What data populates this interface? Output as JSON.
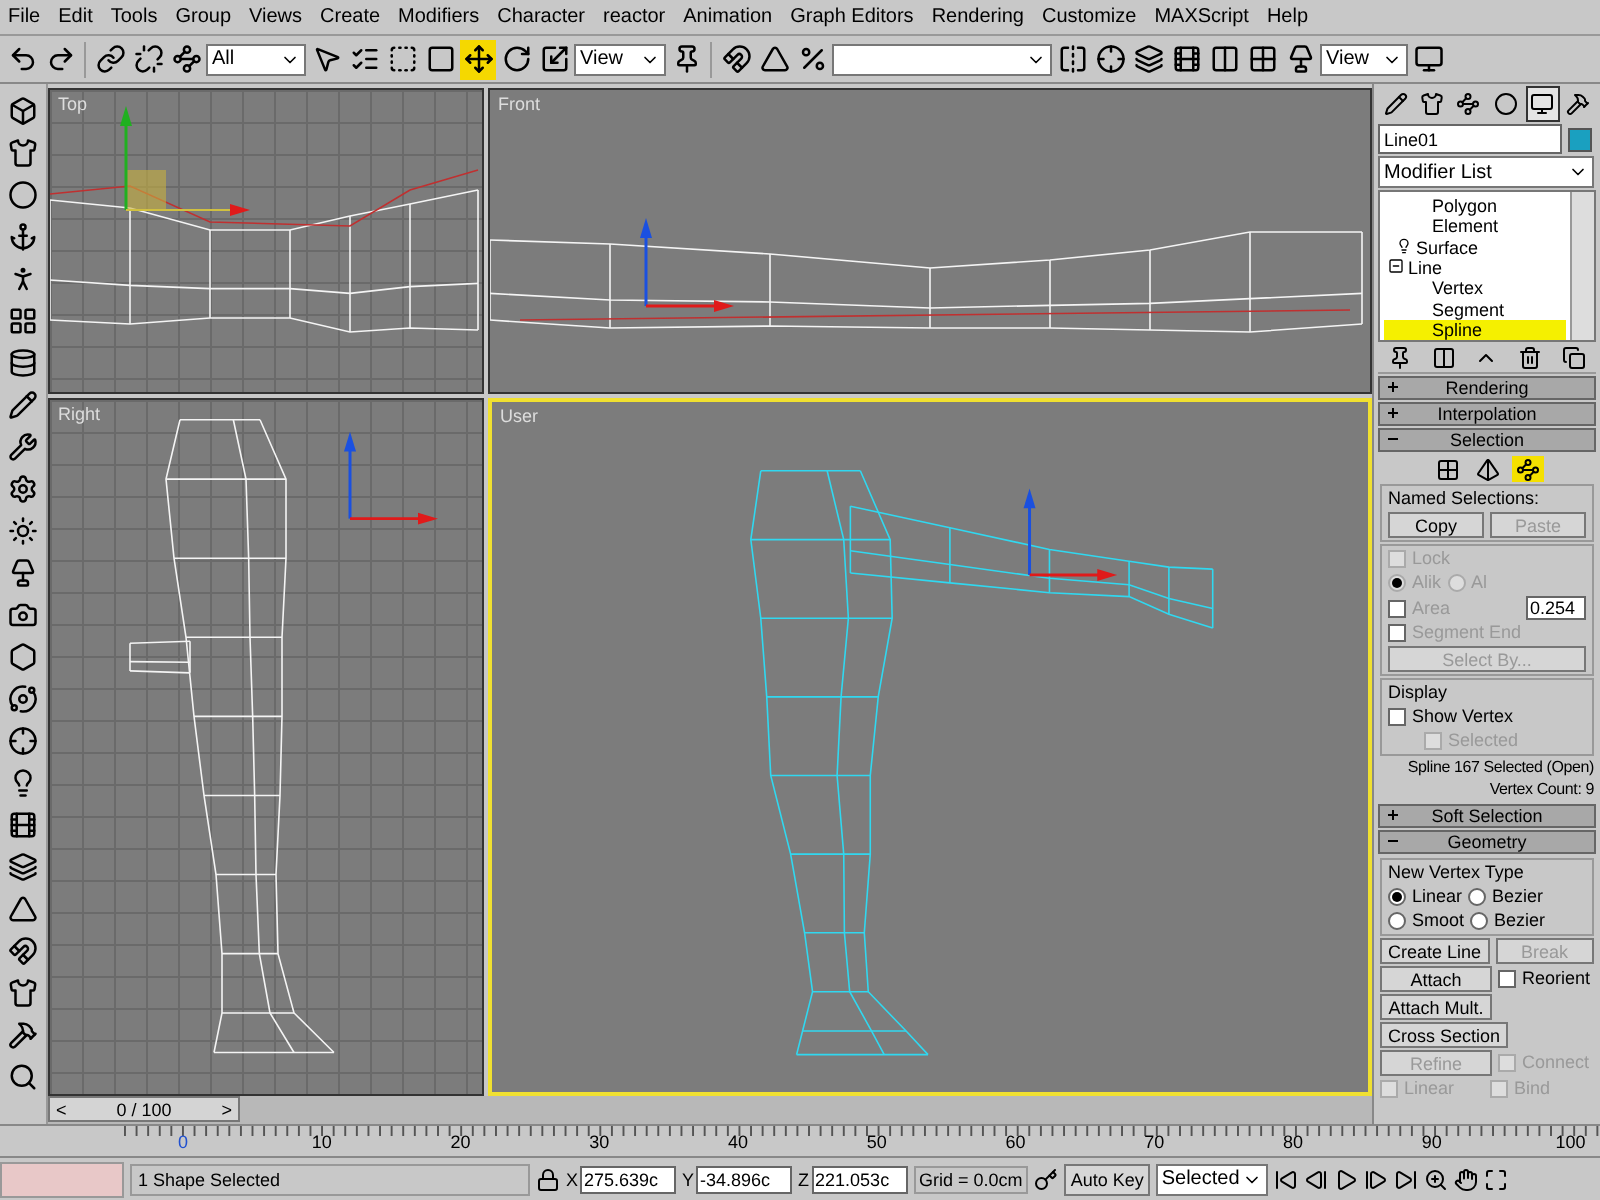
{
  "menu": [
    "File",
    "Edit",
    "Tools",
    "Group",
    "Views",
    "Create",
    "Modifiers",
    "Character",
    "reactor",
    "Animation",
    "Graph Editors",
    "Rendering",
    "Customize",
    "MAXScript",
    "Help"
  ],
  "toolbar": {
    "selection_filter": "All",
    "reference_coordinate": "View",
    "view_dropdown": "View",
    "tools": [
      {
        "kind": "select",
        "selected": false
      },
      {
        "kind": "select_name",
        "selected": false
      },
      {
        "kind": "region",
        "selected": false
      },
      {
        "kind": "window",
        "selected": false
      },
      {
        "kind": "move",
        "selected": true
      },
      {
        "kind": "rotate",
        "selected": false
      },
      {
        "kind": "scale",
        "selected": false
      }
    ]
  },
  "viewports": [
    {
      "label": "Top",
      "kind": "top",
      "active": false
    },
    {
      "label": "Front",
      "kind": "front",
      "active": false
    },
    {
      "label": "Right",
      "kind": "right",
      "active": false
    },
    {
      "label": "User",
      "kind": "user",
      "active": true
    }
  ],
  "command_panel": {
    "tabs": [
      {
        "selected": false
      },
      {
        "selected": false
      },
      {
        "selected": false
      },
      {
        "selected": false
      },
      {
        "selected": true
      },
      {
        "selected": false
      }
    ],
    "object_name": "Line01",
    "modifier_list": "Modifier List",
    "stack": [
      {
        "label": "Polygon",
        "kind": "sub",
        "selected": false
      },
      {
        "label": "Element",
        "kind": "sub",
        "selected": false
      },
      {
        "label": "Surface",
        "kind": "modifier",
        "selected": false
      },
      {
        "label": "Line",
        "kind": "object",
        "selected": false,
        "expanded": true,
        "children": [
          {
            "label": "Vertex",
            "kind": "sub",
            "selected": false
          },
          {
            "label": "Segment",
            "kind": "sub",
            "selected": false
          },
          {
            "label": "Spline",
            "kind": "sub",
            "selected": true
          }
        ]
      }
    ],
    "rollouts": [
      {
        "title": "Rendering",
        "kind": "plain",
        "expanded": false
      },
      {
        "title": "Interpolation",
        "kind": "plain",
        "expanded": false
      },
      {
        "title": "Selection",
        "kind": "selection",
        "expanded": true,
        "subobject_levels": [
          {
            "selected": false
          },
          {
            "selected": false
          },
          {
            "selected": true
          }
        ],
        "named_selections": {
          "label": "Named Selections:",
          "buttons": [
            {
              "label": "Copy",
              "disabled": false
            },
            {
              "label": "Paste",
              "disabled": true
            }
          ]
        },
        "lock": {
          "label": "Lock",
          "checked": false,
          "disabled": true
        },
        "radios": [
          {
            "label": "Alik",
            "selected": true
          },
          {
            "label": "Al",
            "selected": false
          }
        ],
        "area": {
          "label": "Area",
          "checked": false,
          "value": "0.254"
        },
        "segment_end": {
          "label": "Segment End",
          "checked": false
        },
        "select_by": {
          "label": "Select By...",
          "disabled": true
        },
        "display": {
          "label": "Display",
          "show_vertex": {
            "label": "Show Vertex",
            "checked": false
          },
          "selected": {
            "label": "Selected",
            "checked": false,
            "disabled": true
          }
        },
        "info": [
          "Spline 167 Selected (Open)",
          "Vertex Count: 9"
        ]
      },
      {
        "title": "Soft Selection",
        "kind": "plain",
        "expanded": false
      },
      {
        "title": "Geometry",
        "kind": "geometry",
        "expanded": true,
        "new_vertex_type": {
          "label": "New Vertex Type",
          "options": [
            {
              "label": "Linear",
              "selected": true
            },
            {
              "label": "Bezier",
              "selected": false
            },
            {
              "label": "Smoot",
              "selected": false
            },
            {
              "label": "Bezier",
              "selected": false
            }
          ]
        },
        "create_line": {
          "label": "Create Line",
          "disabled": false
        },
        "break": {
          "label": "Break",
          "disabled": true
        },
        "attach": {
          "label": "Attach",
          "disabled": false
        },
        "reorient": {
          "label": "Reorient",
          "checked": false
        },
        "attach_mult": {
          "label": "Attach Mult.",
          "disabled": false
        },
        "cross_section": {
          "label": "Cross Section",
          "disabled": false
        },
        "refine": {
          "label": "Refine",
          "disabled": true
        },
        "connect": {
          "label": "Connect",
          "checked": false,
          "disabled": true
        },
        "linear": {
          "label": "Linear",
          "checked": false,
          "disabled": true
        },
        "bind": {
          "label": "Bind",
          "checked": false,
          "disabled": true
        }
      }
    ]
  },
  "time_slider": {
    "prev": "<",
    "frame": "0 / 100",
    "next": ">"
  },
  "ruler_labels": [
    "0",
    "10",
    "20",
    "30",
    "40",
    "50",
    "60",
    "70",
    "80",
    "90",
    "100"
  ],
  "status_bar": {
    "message": "1 Shape Selected",
    "coords": [
      {
        "axis": "X",
        "value": "275.639c"
      },
      {
        "axis": "Y",
        "value": "-34.896c"
      },
      {
        "axis": "Z",
        "value": "221.053c"
      }
    ],
    "grid": "Grid = 0.0cm",
    "auto_key": {
      "label": "Auto Key",
      "on": false
    },
    "key_mode": "Selected"
  }
}
